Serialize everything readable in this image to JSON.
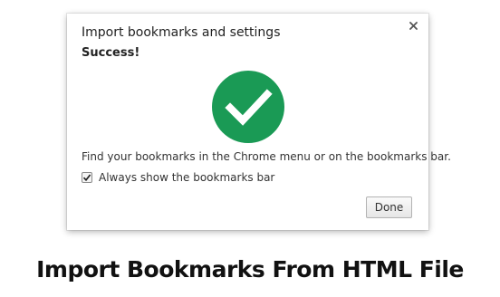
{
  "dialog": {
    "title": "Import bookmarks and settings",
    "status": "Success!",
    "message": "Find your bookmarks in the Chrome menu or on the bookmarks bar.",
    "checkbox": {
      "label": "Always show the bookmarks bar",
      "checked": true
    },
    "done_label": "Done",
    "close_icon": "close-icon",
    "success_icon": "checkmark-circle-icon",
    "success_color": "#1a9a55"
  },
  "caption": "Import Bookmarks From HTML File"
}
